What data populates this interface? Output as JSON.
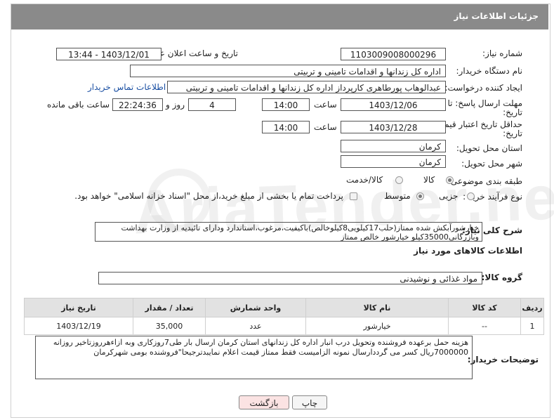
{
  "header": {
    "title": "جزئیات اطلاعات نیاز"
  },
  "form": {
    "need_number_label": "شماره نیاز:",
    "need_number": "1103009008000296",
    "announce_label": "تاریخ و ساعت اعلان عمومی:",
    "announce_value": "1403/12/01 - 13:44",
    "buyer_label": "نام دستگاه خریدار:",
    "buyer_value": "اداره کل زندانها و اقدامات تامینی و تربیتی",
    "creator_label": "ایجاد کننده درخواست:",
    "creator_value": "عبدالوهاب پورطاهری کارپرداز اداره کل زندانها و اقدامات تامینی و تربیتی",
    "contact_link": "اطلاعات تماس خریدار",
    "reply_deadline_label": "مهلت ارسال پاسخ: تا",
    "reply_deadline_label2": "تاریخ:",
    "reply_date": "1403/12/06",
    "time_label": "ساعت",
    "reply_time": "14:00",
    "days_value": "4",
    "days_label": "روز و",
    "remaining_time": "22:24:36",
    "remaining_label": "ساعت باقی مانده",
    "validity_label": "حداقل تاریخ اعتبار قیمت: تا",
    "validity_label2": "تاریخ:",
    "validity_date": "1403/12/28",
    "validity_time": "14:00",
    "province_label": "استان محل تحویل:",
    "province_value": "کرمان",
    "city_label": "شهر محل تحویل:",
    "city_value": "کرمان",
    "category_label": "طبقه بندی موضوعی:",
    "category_options": [
      "کالا",
      "کالا/خدمت"
    ],
    "process_label": "نوع فرآیند خرید :",
    "process_options": [
      "جزیی",
      "متوسط"
    ],
    "payment_note": "پرداخت تمام یا بخشی از مبلغ خرید،از محل \"اسناد خزانه اسلامی\" خواهد بود."
  },
  "description": {
    "label": "شرح کلی نیاز:",
    "text": "خیارشورآبکش شده ممتاز(حلب17کیلویی8کیلوخالص)باکیفیت،مرغوب،استاندارد ودارای تائیدیه از وزارت بهداشت وبازرگانی35000کیلو خیارشور خالص ممتاز"
  },
  "goods_section": {
    "title": "اطلاعات کالاهای مورد نیاز"
  },
  "goods_group": {
    "label": "گروه کالا:",
    "value": "مواد غذائی و نوشیدنی"
  },
  "table": {
    "headers": [
      "ردیف",
      "کد کالا",
      "نام کالا",
      "واحد شمارش",
      "تعداد / مقدار",
      "تاریخ نیاز"
    ],
    "rows": [
      {
        "row": "1",
        "code": "--",
        "name": "خیارشور",
        "unit": "عدد",
        "qty": "35,000",
        "date": "1403/12/19"
      }
    ]
  },
  "buyer_notes": {
    "label": "توضیحات خریدار:",
    "text": "هزینه حمل برعهده فروشنده وتحویل درب انبار اداره کل زندانهای استان کرمان ارسال بار طی7روزکاری وبه ازاءهرروزتاخیر روزانه 7000000ریال کسر می گرددارسال نمونه الزامیست فقط ممتاز قیمت اعلام نمایبدترجیحا\"فروشنده بومی شهرکرمان"
  },
  "buttons": {
    "print": "چاپ",
    "back": "بازگشت"
  },
  "watermark": "AriaTender.neT",
  "colors": {
    "header_bg": "#8a8a8a",
    "link": "#1a4fa3",
    "back_button_bg": "#fbe3e3"
  }
}
